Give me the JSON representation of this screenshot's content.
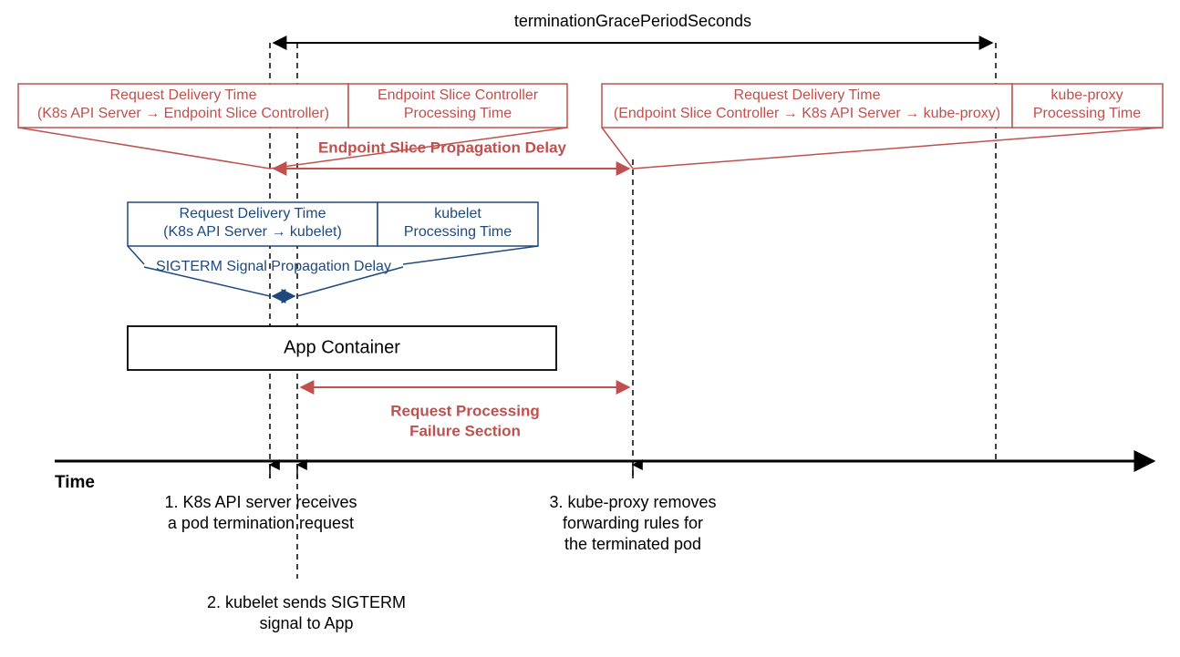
{
  "topLabel": "terminationGracePeriodSeconds",
  "timeLabel": "Time",
  "red": {
    "box1_line1": "Request Delivery Time",
    "box1_line2": "(K8s API Server → Endpoint Slice Controller)",
    "box2_line1": "Endpoint Slice Controller",
    "box2_line2": "Processing Time",
    "box3_line1": "Request Delivery Time",
    "box3_line2": "(Endpoint Slice Controller → K8s API Server → kube-proxy)",
    "box4_line1": "kube-proxy",
    "box4_line2": "Processing Time",
    "propagation": "Endpoint Slice Propagation Delay",
    "failure_line1": "Request Processing",
    "failure_line2": "Failure Section"
  },
  "blue": {
    "box1_line1": "Request Delivery Time",
    "box1_line2": "(K8s API Server → kubelet)",
    "box2_line1": "kubelet",
    "box2_line2": "Processing Time",
    "propagation": "SIGTERM Signal Propagation Delay"
  },
  "app": {
    "label": "App Container"
  },
  "events": {
    "e1_line1": "1. K8s API server receives",
    "e1_line2": "a pod termination request",
    "e2_line1": "2. kubelet sends SIGTERM",
    "e2_line2": "signal to App",
    "e3_line1": "3. kube-proxy removes",
    "e3_line2": "forwarding rules for",
    "e3_line3": "the terminated pod"
  },
  "chart_data": {
    "type": "timeline",
    "axis": "Time",
    "span_label": "terminationGracePeriodSeconds",
    "span_from_event": 1,
    "span_to_event": "end",
    "tracks": [
      {
        "name": "Endpoint Slice Propagation Delay",
        "color": "#C0504D",
        "segments": [
          "Request Delivery Time (K8s API Server → Endpoint Slice Controller)",
          "Endpoint Slice Controller Processing Time",
          "Request Delivery Time (Endpoint Slice Controller → K8s API Server → kube-proxy)",
          "kube-proxy Processing Time"
        ],
        "delay_span": {
          "from_event": 1,
          "to_event": 3
        }
      },
      {
        "name": "SIGTERM Signal Propagation Delay",
        "color": "#1F497D",
        "segments": [
          "Request Delivery Time (K8s API Server → kubelet)",
          "kubelet Processing Time"
        ],
        "delay_span": {
          "from_event": 1,
          "to_event": 2
        }
      },
      {
        "name": "App Container",
        "color": "#000000"
      }
    ],
    "failure_section": {
      "from_event": 2,
      "to_event": 3,
      "label": "Request Processing Failure Section"
    },
    "events": [
      {
        "id": 1,
        "label": "K8s API server receives a pod termination request"
      },
      {
        "id": 2,
        "label": "kubelet sends SIGTERM signal to App"
      },
      {
        "id": 3,
        "label": "kube-proxy removes forwarding rules for the terminated pod"
      }
    ]
  }
}
